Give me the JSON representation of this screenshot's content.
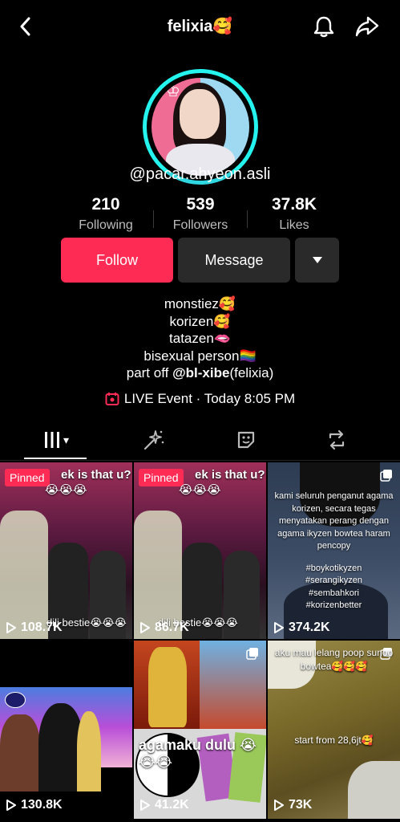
{
  "header": {
    "title": "felixia🥰"
  },
  "profile": {
    "handle": "@pacar.ahyeon.asli",
    "stats": [
      {
        "value": "210",
        "label": "Following"
      },
      {
        "value": "539",
        "label": "Followers"
      },
      {
        "value": "37.8K",
        "label": "Likes"
      }
    ]
  },
  "buttons": {
    "follow": "Follow",
    "message": "Message"
  },
  "bio": {
    "lines": [
      "monstiez🥰",
      "korizen🥰",
      "tatazen🫦",
      "bisexual person🏳️‍🌈"
    ],
    "mention_prefix": "part off ",
    "mention": "@bl-xibe",
    "mention_suffix": "(felixia)"
  },
  "live_event": "LIVE Event · Today 8:05 PM",
  "icons": {
    "back": "chevron-left-icon",
    "bell": "bell-icon",
    "share": "share-icon",
    "more": "caret-down-icon",
    "tabs": [
      "grid-icon",
      "sparkle-icon",
      "sticker-icon",
      "repost-icon"
    ]
  },
  "colors": {
    "accent": "#fe2c55",
    "ring": "#25f4ee",
    "mention": "#ffffff"
  },
  "videos": [
    {
      "pinned": "Pinned",
      "caption_top": "ek is that u?",
      "emoji_top": "😭😭😭",
      "caption_bottom": "dili bestie😭😭😭",
      "views": "108.7K"
    },
    {
      "pinned": "Pinned",
      "caption_top": "ek is that u?",
      "emoji_top": "😭😭😭",
      "caption_bottom": "dili bestie😭😭😭",
      "views": "86.7K"
    },
    {
      "caption_lines": [
        "kami seluruh penganut agama",
        "korizen, secara tegas",
        "menyatakan perang dengan",
        "agama ikyzen bowtea haram",
        "pencopy",
        "",
        "#boykotikyzen",
        "#serangikyzen",
        "#sembahkori",
        "#korizenbetter"
      ],
      "views": "374.2K"
    },
    {
      "views": "130.8K"
    },
    {
      "caption_mid": "agamaku dulu 😭😭😭",
      "views": "41.2K"
    },
    {
      "caption_lines": [
        "aku mau lelang poop sunoo",
        "bowtea🥰🥰🥰",
        "",
        "",
        "",
        "start from 28,6jt🥰"
      ],
      "views": "73K"
    }
  ],
  "tab_labels": {
    "grid_caret": "▾"
  }
}
